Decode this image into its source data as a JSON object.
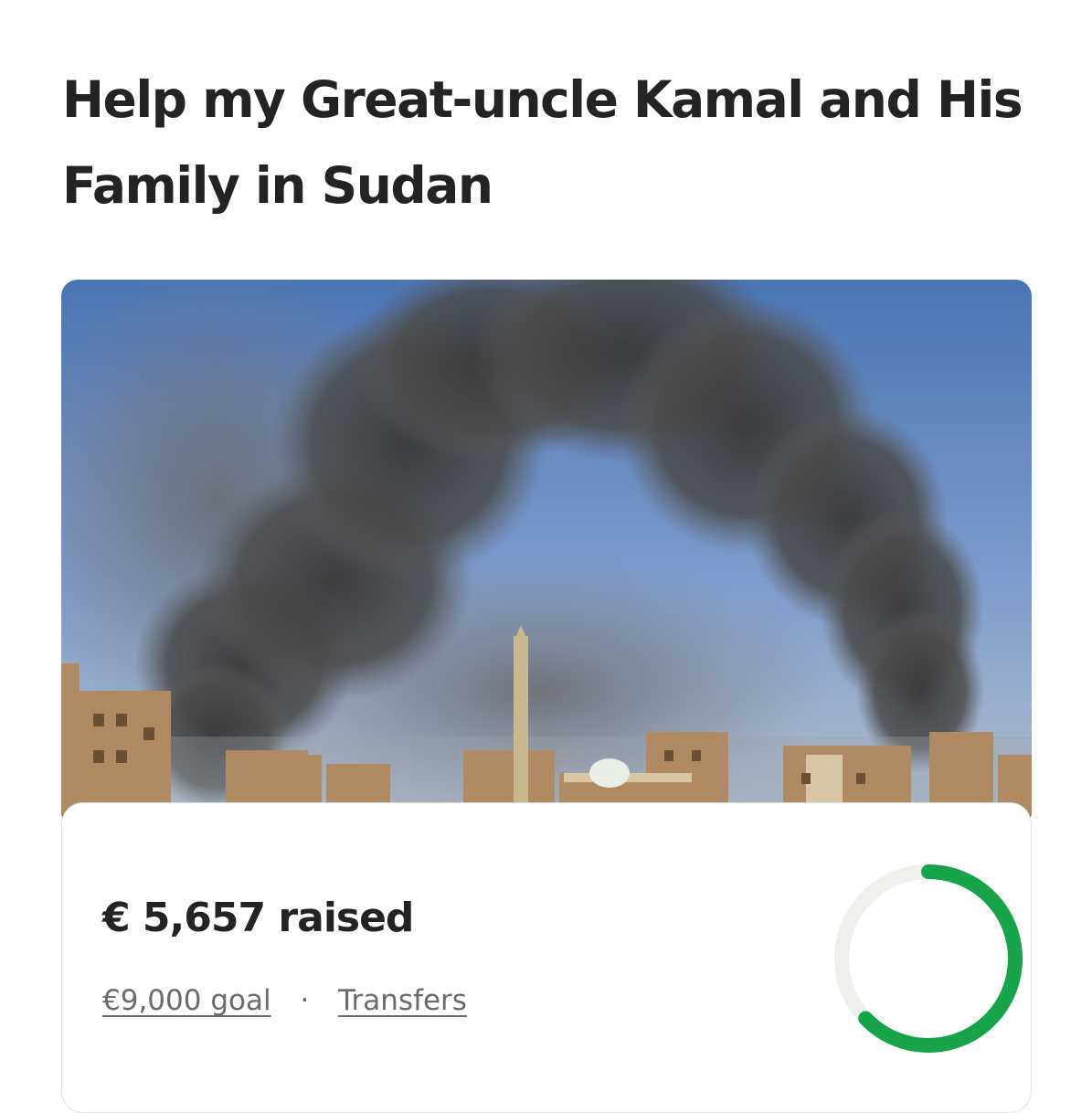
{
  "campaign": {
    "title": "Help my Great-uncle Kamal and His Family in Sudan"
  },
  "progress": {
    "raised_text": "€ 5,657 raised",
    "goal_text": "€9,000 goal",
    "separator": "·",
    "transfers_label": "Transfers",
    "fraction": 0.6286,
    "ring_color": "#16a34a",
    "ring_track_color": "#efefec"
  }
}
